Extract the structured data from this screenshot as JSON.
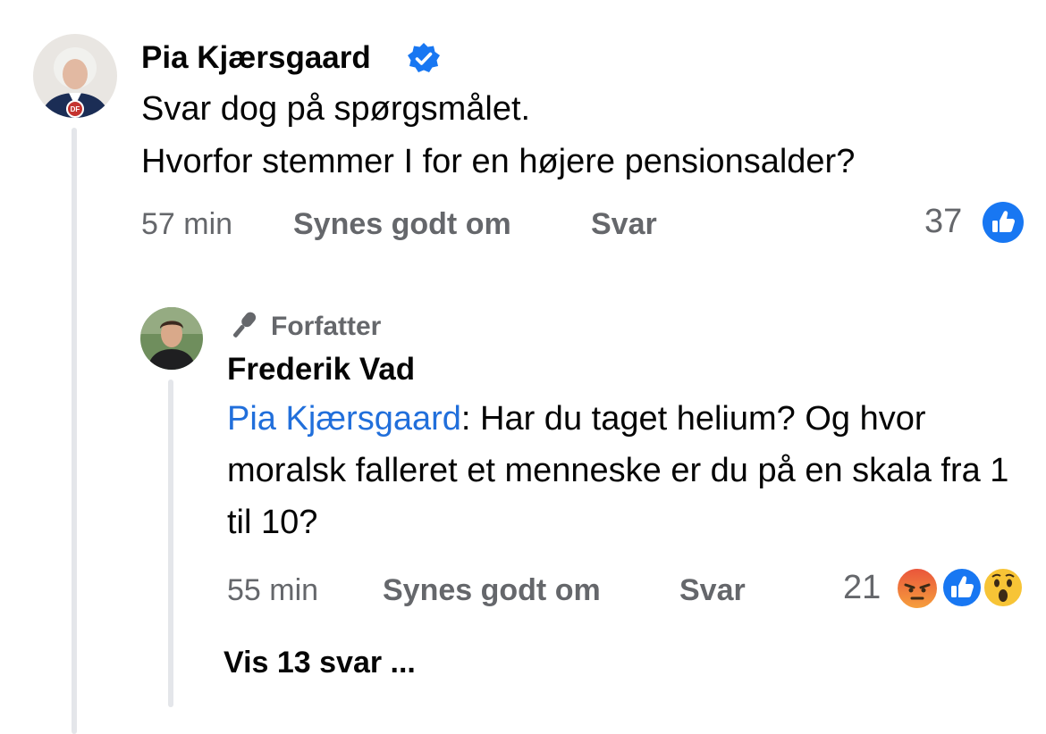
{
  "colors": {
    "like_blue": "#1877f2",
    "mention_blue": "#216fdb",
    "muted_text": "#65676b",
    "thread_line": "#e4e6ea"
  },
  "comment": {
    "author": "Pia Kjærsgaard",
    "verified_icon": "verified-badge-icon",
    "avatar_logo": "DF",
    "lines": [
      "Svar dog på spørgsmålet.",
      "Hvorfor stemmer I for en højere pensionsalder?"
    ],
    "time": "57 min",
    "like_label": "Synes godt om",
    "reply_label": "Svar",
    "reaction_count": "37",
    "reactions": [
      "like-icon"
    ]
  },
  "reply": {
    "badge_icon": "microphone-icon",
    "badge_label": "Forfatter",
    "author": "Frederik Vad",
    "mention": "Pia Kjærsgaard",
    "text": ": Har du taget helium? Og hvor moralsk falleret et menneske er du på en skala fra 1 til 10?",
    "time": "55 min",
    "like_label": "Synes godt om",
    "reply_label": "Svar",
    "reaction_count": "21",
    "reactions": [
      "angry-icon",
      "like-icon",
      "wow-icon"
    ],
    "view_replies_label": "Vis 13 svar ..."
  }
}
